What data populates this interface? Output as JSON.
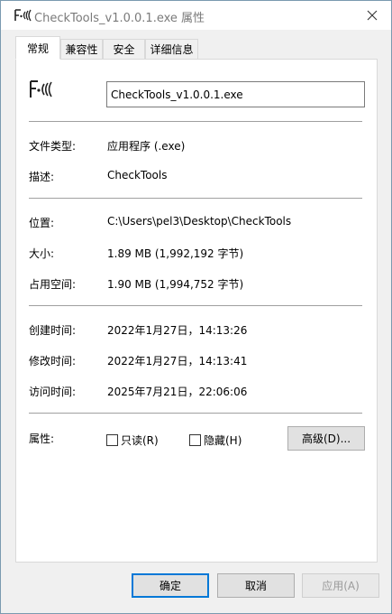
{
  "window": {
    "title": "CheckTools_v1.0.0.1.exe 属性"
  },
  "tabs": [
    {
      "label": "常规"
    },
    {
      "label": "兼容性"
    },
    {
      "label": "安全"
    },
    {
      "label": "详细信息"
    }
  ],
  "general": {
    "file_name": "CheckTools_v1.0.0.1.exe",
    "file_type_label": "文件类型:",
    "file_type_value": "应用程序 (.exe)",
    "description_label": "描述:",
    "description_value": "CheckTools",
    "location_label": "位置:",
    "location_value": "C:\\Users\\pel3\\Desktop\\CheckTools",
    "size_label": "大小:",
    "size_value": "1.89 MB (1,992,192 字节)",
    "size_on_disk_label": "占用空间:",
    "size_on_disk_value": "1.90 MB (1,994,752 字节)",
    "created_label": "创建时间:",
    "created_value": "2022年1月27日，14:13:26",
    "modified_label": "修改时间:",
    "modified_value": "2022年1月27日，14:13:41",
    "accessed_label": "访问时间:",
    "accessed_value": "2025年7月21日，22:06:06",
    "attributes_label": "属性:",
    "readonly_label": "只读(R)",
    "hidden_label": "隐藏(H)",
    "advanced_label": "高级(D)..."
  },
  "footer": {
    "ok_label": "确定",
    "cancel_label": "取消",
    "apply_label": "应用(A)"
  },
  "colors": {
    "accent": "#0078d7",
    "panel_bg": "#ffffff",
    "window_bg": "#f0f0f0"
  }
}
